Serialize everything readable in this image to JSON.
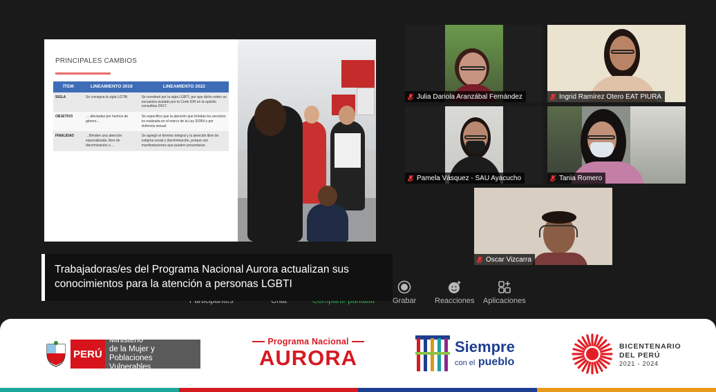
{
  "slide": {
    "title": "PRINCIPALES CAMBIOS",
    "headers": [
      "ÍTEM",
      "LINEAMIENTO 2016",
      "LINEAMIENTO 2022"
    ],
    "rows": [
      {
        "item": "SIGLA",
        "c2016": "Se consigna la sigla LGTBI",
        "c2022": "Se reordenó por la sigla LGBTI, por que dicho orden se encuentra avalado por la Corte IDH en la opinión consultiva 24/17."
      },
      {
        "item": "OBJETIVO",
        "c2016": "… afectadas por hechos de género…",
        "c2022": "Se específico que la atención que brindan los servicios es realizada en el marco de la Ley 30364 y por violencia sexual."
      },
      {
        "item": "FINALIDAD",
        "c2016": "…Brinden una atención especializada, libre de discriminación a …",
        "c2022": "Se agregó el término integral y la atención libre de estigma social y discriminación, porque son manifestaciones que pueden presentarse."
      }
    ]
  },
  "participants": [
    {
      "name": "Julia Dariola Aranzábal Fernández",
      "muted": true
    },
    {
      "name": "Ingrid Ramírez Otero EAT PIURA",
      "muted": true
    },
    {
      "name": "Pamela Vásquez - SAU Ayacucho",
      "muted": true
    },
    {
      "name": "Tania Romero",
      "muted": true
    },
    {
      "name": "Oscar Vizcarra",
      "muted": true
    }
  ],
  "caption": {
    "line1": "Trabajadoras/es del Programa Nacional Aurora actualizan sus",
    "line2": "conocimientos para la atención a personas LGBTI"
  },
  "toolbar": {
    "participants": "Participantes",
    "chat": "Chat",
    "share": "Compartir pantalla",
    "record": "Grabar",
    "reactions": "Reacciones",
    "apps": "Aplicaciones"
  },
  "footer": {
    "mimp_country": "PERÚ",
    "mimp_line1": "Ministerio",
    "mimp_line2": "de la Mujer y",
    "mimp_line3": "Poblaciones Vulnerables",
    "aurora_top": "Programa Nacional",
    "aurora_main": "AURORA",
    "siempre_line1": "Siempre",
    "siempre_con": "con el",
    "siempre_pueblo": "pueblo",
    "bicent_line1": "BICENTENARIO",
    "bicent_line2": "DEL PERÚ",
    "bicent_line3": "2021 - 2024"
  },
  "colors": {
    "brand_red": "#d51a22",
    "brand_blue": "#1e3f8f",
    "share_green": "#26b34a",
    "table_header": "#3f6cb7"
  }
}
